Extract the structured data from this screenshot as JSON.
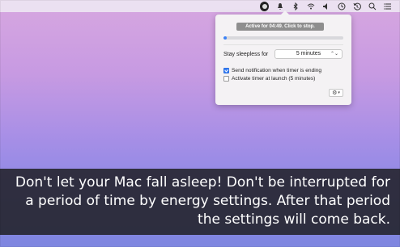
{
  "menubar": {
    "icons": [
      "amphetamine-active-icon",
      "notifications-icon",
      "bluetooth-icon",
      "wifi-icon",
      "volume-icon",
      "clock-icon",
      "time-machine-icon",
      "search-icon",
      "list-icon"
    ]
  },
  "popover": {
    "active_button": "Active for 04:49. Click to stop.",
    "progress_fraction": 0.03,
    "stay_label": "Stay sleepless for",
    "duration_value": "5 minutes",
    "notify_label": "Send notification when timer is ending",
    "notify_checked": true,
    "launch_label": "Activate timer at launch (5 minutes)",
    "launch_checked": false
  },
  "caption": {
    "text": "Don't let your Mac fall asleep! Don't be interrupted for a period of time by energy settings. After that period the settings will come back."
  },
  "colors": {
    "accent": "#3b82f6",
    "caption_bg": "#202024"
  }
}
